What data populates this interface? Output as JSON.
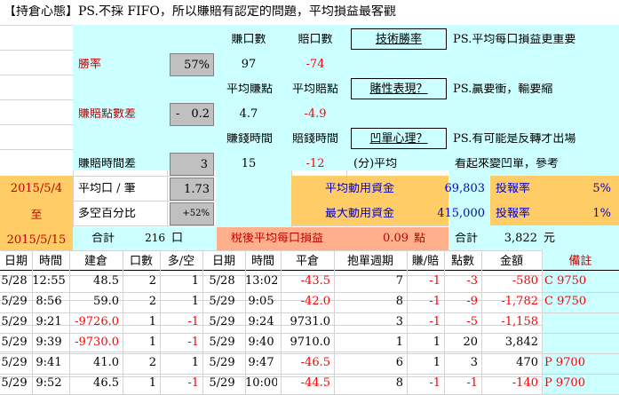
{
  "title": "【持倉心態】PS.不採 FIFO，所以賺賠有認定的問題，平均損益最客觀",
  "stats": {
    "col_win_count": "賺口數",
    "col_loss_count": "賠口數",
    "tech_link": "技術勝率",
    "note1": "PS.平均每口損益更重要",
    "win_rate_label": "勝率",
    "win_rate_value": "57%",
    "win_count": "97",
    "loss_count": "-74",
    "avg_win_pts_label": "平均賺點",
    "avg_loss_pts_label": "平均賠點",
    "gamble_link": "賭性表現？",
    "note2": "PS.贏要衝，輸要縮",
    "pts_diff_label": "賺賠點數差",
    "pts_diff_sign": "-",
    "pts_diff_value": "0.2",
    "avg_win_pts": "4.7",
    "avg_loss_pts": "-4.9",
    "win_time_label": "賺錢時間",
    "loss_time_label": "賠錢時間",
    "trap_link": "凹單心理？",
    "note3": "PS.有可能是反轉才出場",
    "time_diff_label": "賺賠時間差",
    "time_diff_value": "3",
    "win_time": "15",
    "loss_time": "-12",
    "avg_min_label": "(分)平均",
    "note4": "看起來變凹單，參考"
  },
  "period": {
    "start": "2015/5/4",
    "mid": "至",
    "end": "2015/5/15"
  },
  "summary": {
    "avg_lot_label": "平均口 / 筆",
    "avg_lot_value": "1.73",
    "long_short_label": "多空百分比",
    "long_short_value": "+52%",
    "total_label": "合計",
    "total_lots": "216",
    "lot_unit": "口",
    "avg_capital_label": "平均動用資金",
    "avg_capital_value": "69,803",
    "roi1_label": "投報率",
    "roi1_value": "5%",
    "max_capital_label": "最大動用資金",
    "max_capital_value": "415,000",
    "roi2_label": "投報率",
    "roi2_value": "1%",
    "after_tax_label": "稅後平均每口損益",
    "after_tax_value": "0.09",
    "after_tax_unit": "點",
    "total_amount_label": "合計",
    "total_amount_value": "3,822",
    "total_amount_unit": "元"
  },
  "table": {
    "headers": [
      "日期",
      "時間",
      "建倉",
      "口數",
      "多/空",
      "日期",
      "時間",
      "平倉",
      "抱單週期",
      "賺/賠",
      "點數",
      "金額",
      "備註"
    ],
    "rows": [
      [
        "5/28",
        "12:55",
        "48.5",
        "2",
        "1",
        "5/28",
        "13:02",
        "-43.5",
        "7",
        "-1",
        "-3",
        "-580",
        "C 9750"
      ],
      [
        "5/29",
        "8:56",
        "59.0",
        "2",
        "1",
        "5/29",
        "9:05",
        "-42.0",
        "8",
        "-1",
        "-9",
        "-1,782",
        "C 9750"
      ],
      [
        "5/29",
        "9:21",
        "-9726.0",
        "1",
        "-1",
        "5/29",
        "9:24",
        "9731.0",
        "3",
        "-1",
        "-5",
        "-1,158",
        ""
      ],
      [
        "5/29",
        "9:39",
        "-9730.0",
        "1",
        "-1",
        "5/29",
        "9:40",
        "9710.0",
        "1",
        "1",
        "20",
        "3,842",
        ""
      ],
      [
        "5/29",
        "9:41",
        "41.0",
        "2",
        "1",
        "5/29",
        "9:47",
        "-46.5",
        "6",
        "1",
        "3",
        "470",
        "P 9700"
      ],
      [
        "5/29",
        "9:52",
        "46.5",
        "1",
        "-1",
        "5/29",
        "10:00",
        "-44.5",
        "8",
        "-1",
        "-1",
        "-140",
        "P 9700"
      ]
    ]
  }
}
